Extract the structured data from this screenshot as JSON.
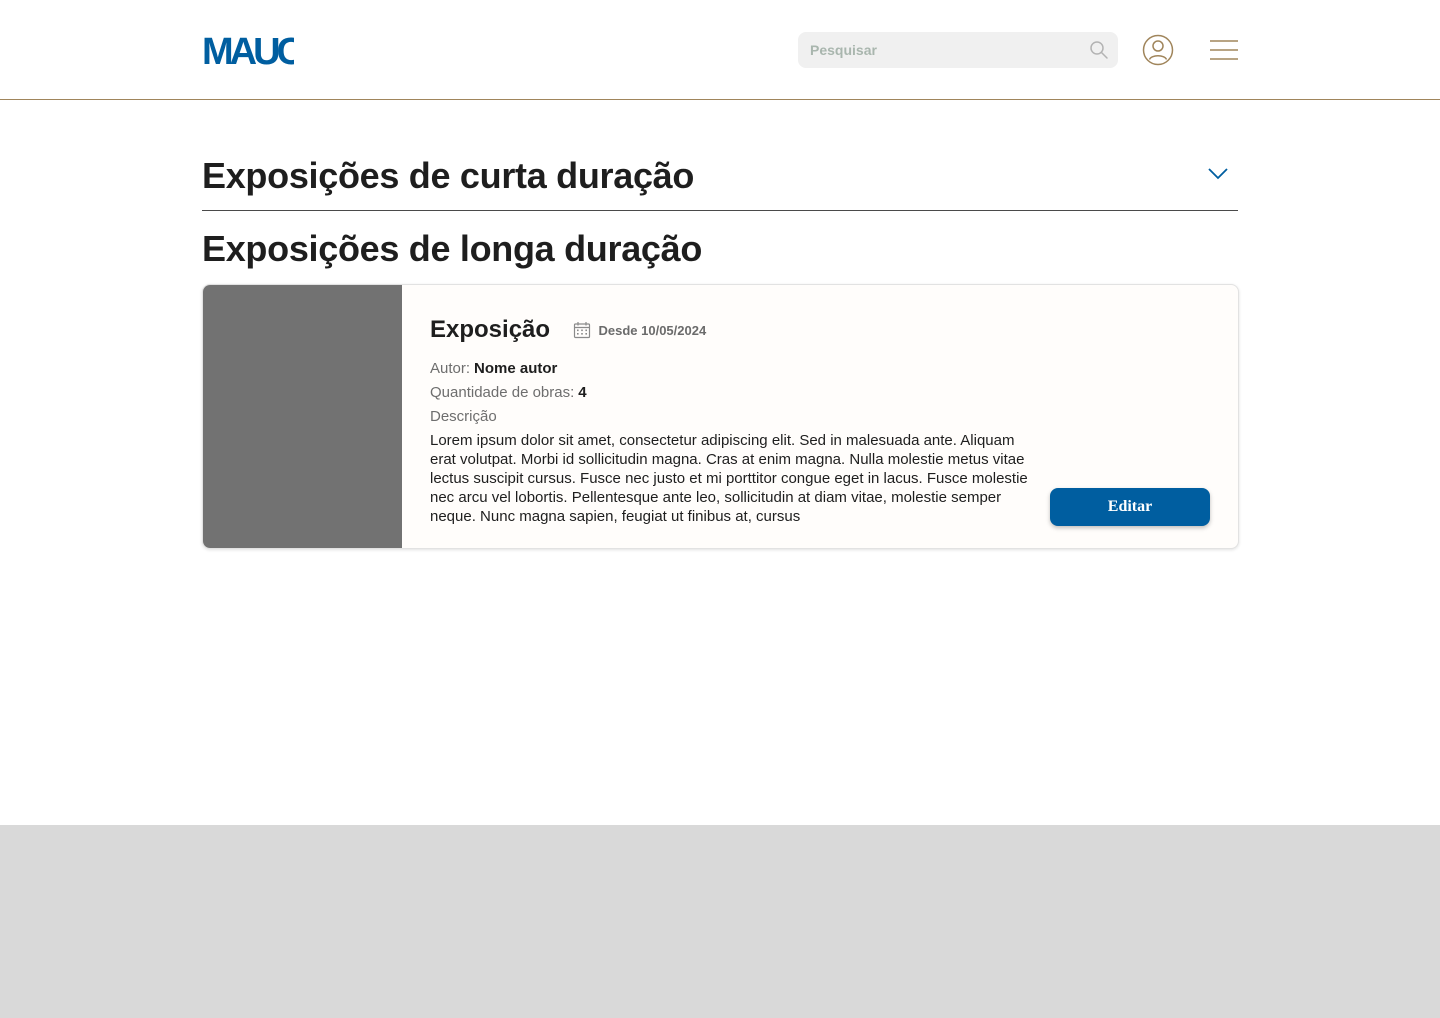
{
  "header": {
    "logo_text": "MAUC",
    "search": {
      "placeholder": "Pesquisar",
      "value": ""
    },
    "icons": {
      "search": "search-icon",
      "user": "user-icon",
      "menu": "hamburger-menu-icon"
    }
  },
  "sections": {
    "short": {
      "title": "Exposições de curta duração",
      "expanded": false,
      "icon": "chevron-down-icon"
    },
    "long": {
      "title": "Exposições de longa duração"
    }
  },
  "exhibition": {
    "title": "Exposição",
    "date_icon": "calendar-icon",
    "date": "Desde 10/05/2024",
    "author_label": "Autor:",
    "author_value": "Nome autor",
    "works_label": "Quantidade de obras:",
    "works_value": "4",
    "description_label": "Descrição",
    "description": "Lorem ipsum dolor sit amet, consectetur adipiscing elit. Sed in  malesuada ante. Aliquam erat volutpat. Morbi id sollicitudin magna. Cras at enim magna. Nulla molestie metus vitae lectus suscipit cursus. Fusce nec justo et mi porttitor congue eget in lacus. Fusce molestie nec arcu vel lobortis. Pellentesque ante leo, sollicitudin at diam vitae,  molestie semper neque. Nunc magna sapien, feugiat ut finibus at, cursus",
    "edit_label": "Editar"
  },
  "colors": {
    "brand_blue": "#005ea0",
    "header_border": "#a0855b",
    "footer_bg": "#d9d9d9",
    "image_placeholder": "#727272"
  }
}
